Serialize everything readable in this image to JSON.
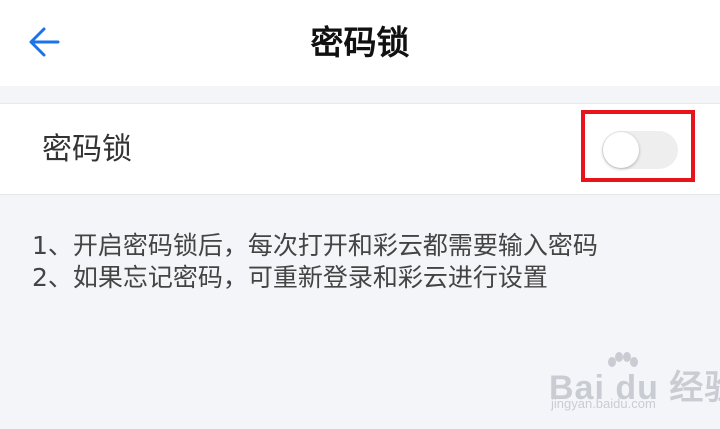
{
  "header": {
    "title": "密码锁",
    "back_icon": "arrow-left-icon"
  },
  "colors": {
    "accent": "#1a73e8",
    "highlight_box": "#e8141c",
    "background": "#f4f5f9",
    "toggle_track_off": "#eeeeef"
  },
  "settings": {
    "password_lock": {
      "label": "密码锁",
      "enabled": false
    }
  },
  "notes": [
    "1、开启密码锁后，每次打开和彩云都需要输入密码",
    "2、如果忘记密码，可重新登录和彩云进行设置"
  ],
  "watermark": {
    "brand": "Bai du 经验",
    "url": "jingyan.baidu.com"
  }
}
